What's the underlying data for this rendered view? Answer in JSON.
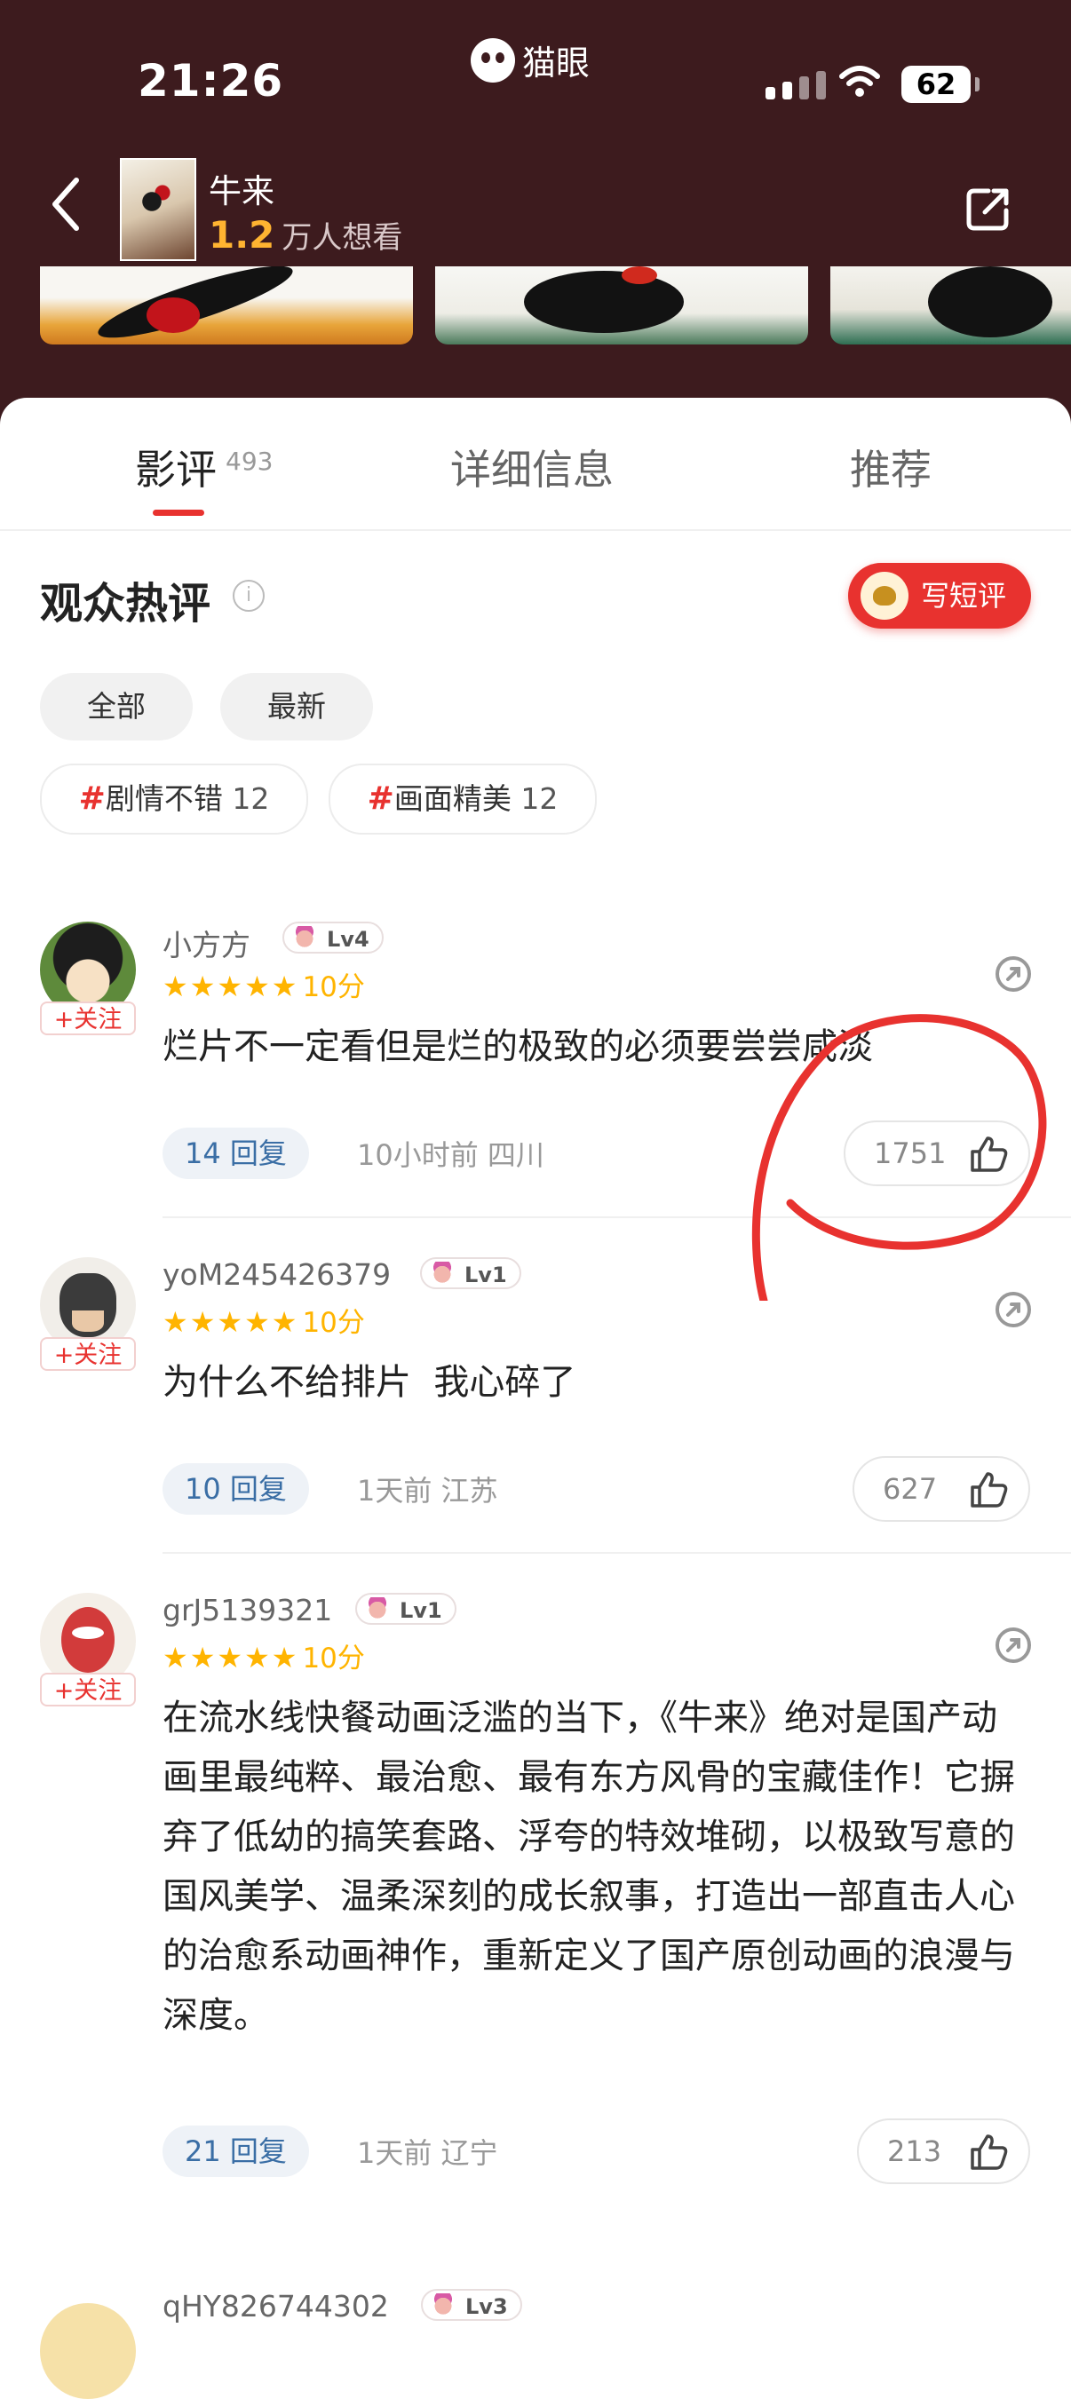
{
  "status_bar": {
    "time": "21:26",
    "app_name": "猫眼",
    "battery": "62"
  },
  "movie": {
    "title": "牛来",
    "want_count": "1.2",
    "want_label": "万人想看"
  },
  "tabs": [
    {
      "label": "影评",
      "count": "493"
    },
    {
      "label": "详细信息"
    },
    {
      "label": "推荐"
    }
  ],
  "section": {
    "title": "观众热评",
    "info_icon": "i",
    "write_button": "写短评"
  },
  "filters": [
    "全部",
    "最新"
  ],
  "tags": [
    {
      "hash": "#",
      "name": "剧情不错",
      "count": "12"
    },
    {
      "hash": "#",
      "name": "画面精美",
      "count": "12"
    }
  ],
  "follow_label": "+关注",
  "reviews": [
    {
      "username": "小方方",
      "level": "Lv4",
      "stars": "★★★★★",
      "score": "10分",
      "text": "烂片不一定看但是烂的极致的必须要尝尝咸淡",
      "replies": "14 回复",
      "time": "10小时前",
      "location": "四川",
      "likes": "1751"
    },
    {
      "username": "yoM245426379",
      "level": "Lv1",
      "stars": "★★★★★",
      "score": "10分",
      "text": "为什么不给排片  我心碎了",
      "replies": "10 回复",
      "time": "1天前",
      "location": "江苏",
      "likes": "627"
    },
    {
      "username": "grJ5139321",
      "level": "Lv1",
      "stars": "★★★★★",
      "score": "10分",
      "text": "在流水线快餐动画泛滥的当下，《牛来》绝对是国产动画里最纯粹、最治愈、最有东方风骨的宝藏佳作！它摒弃了低幼的搞笑套路、浮夸的特效堆砌，以极致写意的国风美学、温柔深刻的成长叙事，打造出一部直击人心的治愈系动画神作，重新定义了国产原创动画的浪漫与深度。",
      "replies": "21 回复",
      "time": "1天前",
      "location": "辽宁",
      "likes": "213"
    },
    {
      "username": "qHY826744302",
      "level": "Lv3"
    }
  ],
  "colors": {
    "header_bg": "#3d1b1e",
    "accent": "#e8322f",
    "star": "#ffb400",
    "want_num": "#ffb431",
    "annotation": "#e8322f"
  },
  "icons": [
    "back-icon",
    "share-icon",
    "thumbs-up-icon",
    "info-icon",
    "wifi-icon",
    "signal-icon",
    "battery-icon",
    "cat-logo-icon"
  ]
}
